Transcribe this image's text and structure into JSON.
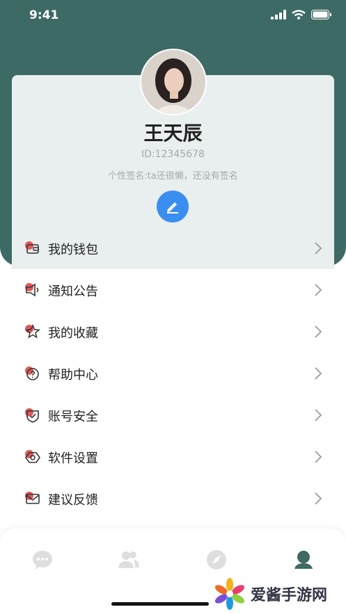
{
  "status_bar": {
    "time": "9:41"
  },
  "profile": {
    "name": "王天辰",
    "id_text": "ID:12345678",
    "signature": "个性签名:ta还很懒，还没有签名"
  },
  "menu": [
    {
      "label": "我的钱包",
      "icon": "wallet-icon"
    },
    {
      "label": "通知公告",
      "icon": "speaker-icon"
    },
    {
      "label": "我的收藏",
      "icon": "star-icon"
    },
    {
      "label": "帮助中心",
      "icon": "help-icon"
    },
    {
      "label": "账号安全",
      "icon": "shield-icon"
    },
    {
      "label": "软件设置",
      "icon": "settings-icon"
    },
    {
      "label": "建议反馈",
      "icon": "mail-icon"
    }
  ],
  "tabs": [
    "chat-icon",
    "contacts-icon",
    "discover-icon",
    "profile-icon"
  ],
  "watermark": {
    "text": "爱酱手游网"
  },
  "colors": {
    "header": "#3e6a66",
    "accent": "#3a8ef0",
    "icon_red": "#e05a5a"
  }
}
